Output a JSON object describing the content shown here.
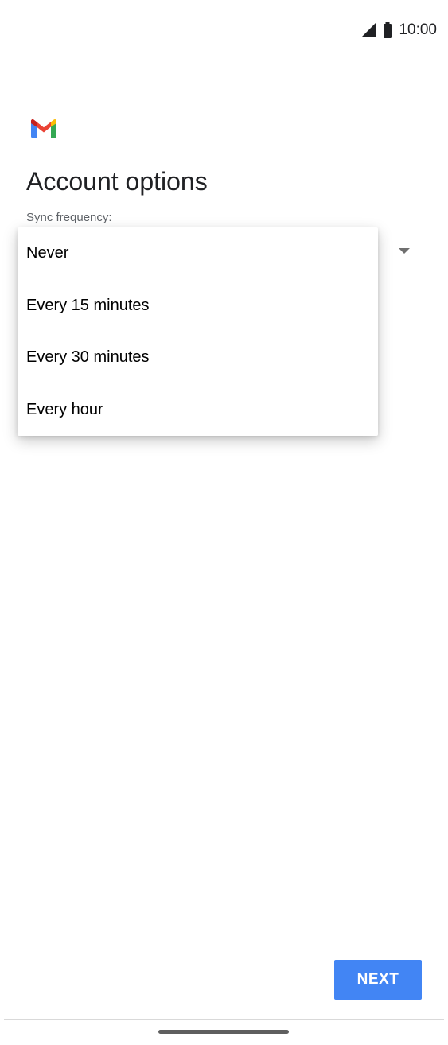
{
  "status_bar": {
    "time": "10:00",
    "icons": [
      "signal-icon",
      "battery-icon"
    ]
  },
  "app": {
    "logo_icon": "gmail-logo-icon"
  },
  "page": {
    "title": "Account options",
    "sync_label": "Sync frequency:"
  },
  "dropdown": {
    "options": [
      "Never",
      "Every 15 minutes",
      "Every 30 minutes",
      "Every hour"
    ]
  },
  "actions": {
    "next_label": "NEXT"
  },
  "colors": {
    "accent": "#4285f4",
    "text_primary": "#202124",
    "text_secondary": "#5f6368"
  }
}
